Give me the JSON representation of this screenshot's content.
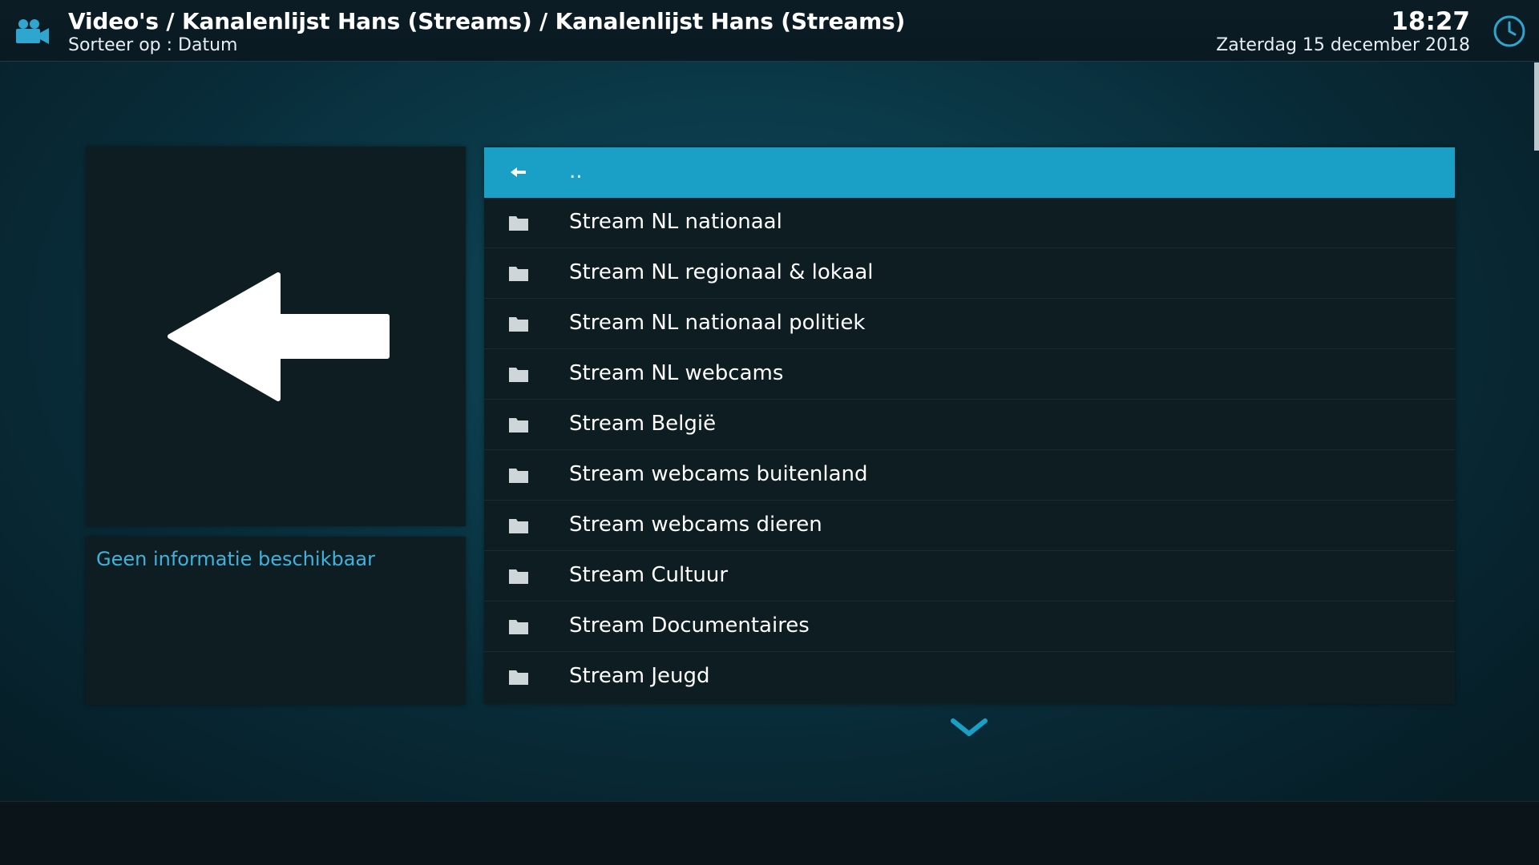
{
  "header": {
    "app_icon": "video-camera-icon",
    "breadcrumb": "Video's / Kanalenlijst Hans (Streams) / Kanalenlijst Hans (Streams)",
    "sort_label": "Sorteer op : Datum",
    "time": "18:27",
    "date": "Zaterdag 15 december 2018",
    "clock_icon": "clock-icon"
  },
  "colors": {
    "accent": "#1aa0c6",
    "info_text": "#3fb3dc"
  },
  "thumbnail": {
    "icon": "back-arrow-icon"
  },
  "info": {
    "text": "Geen informatie beschikbaar"
  },
  "list": {
    "items": [
      {
        "label": "..",
        "icon": "back-arrow-icon"
      },
      {
        "label": "Stream NL nationaal",
        "icon": "folder-icon"
      },
      {
        "label": "Stream NL regionaal & lokaal",
        "icon": "folder-icon"
      },
      {
        "label": "Stream NL nationaal politiek",
        "icon": "folder-icon"
      },
      {
        "label": "Stream NL webcams",
        "icon": "folder-icon"
      },
      {
        "label": "Stream België",
        "icon": "folder-icon"
      },
      {
        "label": "Stream webcams buitenland",
        "icon": "folder-icon"
      },
      {
        "label": "Stream webcams dieren",
        "icon": "folder-icon"
      },
      {
        "label": "Stream Cultuur",
        "icon": "folder-icon"
      },
      {
        "label": "Stream Documentaires",
        "icon": "folder-icon"
      },
      {
        "label": "Stream Jeugd",
        "icon": "folder-icon"
      }
    ],
    "scroll_icon": "chevron-down-icon"
  }
}
